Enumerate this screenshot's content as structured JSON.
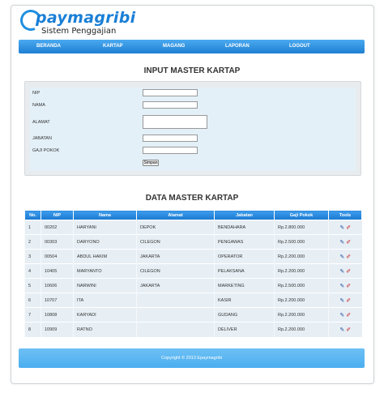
{
  "brand": {
    "name": "paymagribi",
    "tagline": "Sistem Penggajian",
    "accent": "#1a7fd6"
  },
  "nav": {
    "items": [
      {
        "label": "BERANDA"
      },
      {
        "label": "KARTAP"
      },
      {
        "label": "MAGANG"
      },
      {
        "label": "LAPORAN"
      },
      {
        "label": "LOGOUT"
      }
    ]
  },
  "form": {
    "title": "INPUT MASTER KARTAP",
    "fields": {
      "nip": {
        "label": "NIP",
        "value": ""
      },
      "nama": {
        "label": "NAMA",
        "value": ""
      },
      "alamat": {
        "label": "ALAMAT",
        "value": ""
      },
      "jabatan": {
        "label": "JABATAN",
        "value": ""
      },
      "gaji_pokok": {
        "label": "GAJI POKOK",
        "value": ""
      }
    },
    "submit_label": "Simpan"
  },
  "table": {
    "title": "DATA MASTER KARTAP",
    "headers": [
      "No.",
      "NIP",
      "Nama",
      "Alamat",
      "Jabatan",
      "Gaji Pokok",
      "Tools"
    ],
    "rows": [
      [
        "1",
        "00202",
        "HARYANI",
        "DEPOK",
        "BENDAHARA",
        "Rp.2.800.000"
      ],
      [
        "2",
        "00303",
        "DARYONO",
        "CILEGON",
        "PENGAWAS",
        "Rp.2.500.000"
      ],
      [
        "3",
        "00504",
        "ABDUL HAKIM",
        "JAKARTA",
        "OPERATOR",
        "Rp.2.200.000"
      ],
      [
        "4",
        "10405",
        "MARYANTO",
        "CILEGON",
        "PELAKSANA",
        "Rp.2.200.000"
      ],
      [
        "5",
        "10606",
        "NARWINI",
        "JAKARTA",
        "MARKETING",
        "Rp.2.500.000"
      ],
      [
        "6",
        "10707",
        "ITA",
        "",
        "KASIR",
        "Rp.2.200.000"
      ],
      [
        "7",
        "10808",
        "KARYADI",
        "",
        "GUDANG",
        "Rp.2.200.000"
      ],
      [
        "8",
        "10909",
        "RATNO",
        "",
        "DELIVER",
        "Rp.2.200.000"
      ]
    ],
    "tools": {
      "edit_icon": "pencil-icon",
      "delete_icon": "eraser-icon"
    }
  },
  "footer": {
    "text": "Copyright © 2013 Epaymagribi"
  }
}
